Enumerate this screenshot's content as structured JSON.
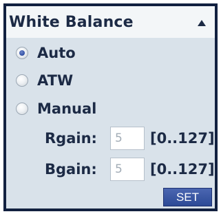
{
  "panel": {
    "title": "White Balance",
    "collapse_icon": "triangle-up-icon"
  },
  "modes": [
    {
      "label": "Auto",
      "checked": true
    },
    {
      "label": "ATW",
      "checked": false
    },
    {
      "label": "Manual",
      "checked": false
    }
  ],
  "fields": {
    "rgain": {
      "label": "Rgain:",
      "value": "5",
      "range": "[0..127]"
    },
    "bgain": {
      "label": "Bgain:",
      "value": "5",
      "range": "[0..127]"
    }
  },
  "set_button": {
    "label": "SET"
  },
  "colors": {
    "frame": "#122140",
    "panel_bg": "#d9e2ea",
    "header_bg": "#f3f6f8",
    "text": "#1c2a45",
    "button": "#3a58a6"
  }
}
